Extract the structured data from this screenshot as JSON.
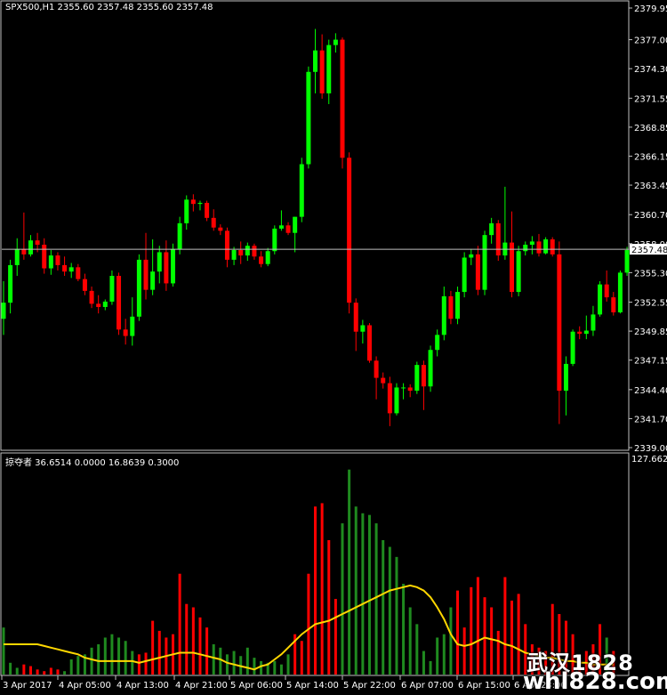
{
  "window": {
    "symbol_label": "SPX500,H1  2355.60 2357.48 2355.60 2357.48",
    "indicator_label": "掠夺者 36.6514 0.0000 16.8639 0.3000",
    "indicator_max": "127.6628",
    "current_price": "2357.48"
  },
  "colors": {
    "background": "#000000",
    "bull": "#00ff00",
    "bear": "#ff0000",
    "grid": "#c0c0c0",
    "price_line": "#c0c0c0",
    "ma_line": "#ffd700",
    "text": "#ffffff"
  },
  "price_axis_labels": [
    "2379.95",
    "2377.00",
    "2374.30",
    "2371.55",
    "2368.85",
    "2366.15",
    "2363.45",
    "2360.70",
    "2358.00",
    "2355.30",
    "2352.55",
    "2349.85",
    "2347.15",
    "2344.40",
    "2341.70",
    "2339.00"
  ],
  "time_axis_labels": [
    "3 Apr 2017",
    "4 Apr 05:00",
    "4 Apr 13:00",
    "4 Apr 21:00",
    "5 Apr 06:00",
    "5 Apr 14:00",
    "5 Apr 22:00",
    "6 Apr 07:00",
    "6 Apr 15:00",
    "6 Apr 23:00"
  ],
  "watermark": {
    "line1": "武汉1828",
    "line2": "whl828.com"
  },
  "chart_data": [
    {
      "type": "candlestick",
      "title": "SPX500,H1",
      "ylim": [
        2339.0,
        2379.95
      ],
      "candles": [
        [
          2351.0,
          2354.5,
          2349.5,
          2352.5
        ],
        [
          2352.5,
          2356.5,
          2351.5,
          2356.0
        ],
        [
          2356.0,
          2358.5,
          2355.0,
          2357.5
        ],
        [
          2357.5,
          2360.9,
          2356.5,
          2357.0
        ],
        [
          2357.0,
          2358.8,
          2356.8,
          2358.3
        ],
        [
          2358.3,
          2359.0,
          2357.2,
          2357.9
        ],
        [
          2357.9,
          2358.5,
          2355.2,
          2355.7
        ],
        [
          2355.7,
          2357.4,
          2355.1,
          2356.9
        ],
        [
          2356.9,
          2357.2,
          2355.5,
          2356.0
        ],
        [
          2356.0,
          2356.8,
          2355.0,
          2355.4
        ],
        [
          2355.4,
          2356.2,
          2354.8,
          2355.8
        ],
        [
          2355.8,
          2356.1,
          2354.5,
          2354.7
        ],
        [
          2354.7,
          2355.2,
          2353.2,
          2353.6
        ],
        [
          2353.6,
          2354.0,
          2352.0,
          2352.4
        ],
        [
          2352.4,
          2353.2,
          2351.5,
          2352.1
        ],
        [
          2352.1,
          2352.8,
          2351.8,
          2352.6
        ],
        [
          2352.6,
          2355.5,
          2352.3,
          2355.0
        ],
        [
          2355.0,
          2355.3,
          2349.5,
          2350.0
        ],
        [
          2350.0,
          2351.0,
          2348.6,
          2349.4
        ],
        [
          2349.4,
          2353.0,
          2348.5,
          2351.2
        ],
        [
          2351.2,
          2357.0,
          2350.8,
          2356.5
        ],
        [
          2356.5,
          2359.0,
          2352.8,
          2353.7
        ],
        [
          2353.7,
          2358.4,
          2353.2,
          2355.4
        ],
        [
          2355.4,
          2357.8,
          2354.3,
          2357.2
        ],
        [
          2357.2,
          2358.3,
          2353.6,
          2354.3
        ],
        [
          2354.3,
          2358.0,
          2354.0,
          2357.5
        ],
        [
          2357.5,
          2360.5,
          2357.0,
          2359.9
        ],
        [
          2359.9,
          2362.5,
          2359.3,
          2362.1
        ],
        [
          2362.1,
          2362.6,
          2361.0,
          2361.7
        ],
        [
          2361.7,
          2362.0,
          2361.1,
          2361.8
        ],
        [
          2361.8,
          2362.0,
          2360.1,
          2360.4
        ],
        [
          2360.4,
          2361.2,
          2359.2,
          2359.5
        ],
        [
          2359.5,
          2359.8,
          2358.8,
          2359.2
        ],
        [
          2359.2,
          2359.5,
          2355.8,
          2356.5
        ],
        [
          2356.5,
          2357.7,
          2356.0,
          2357.4
        ],
        [
          2357.4,
          2358.2,
          2356.1,
          2356.9
        ],
        [
          2356.9,
          2358.1,
          2356.4,
          2357.8
        ],
        [
          2357.8,
          2358.0,
          2356.5,
          2356.8
        ],
        [
          2356.8,
          2357.3,
          2355.8,
          2356.1
        ],
        [
          2356.1,
          2357.6,
          2355.9,
          2357.3
        ],
        [
          2357.3,
          2359.7,
          2357.0,
          2359.4
        ],
        [
          2359.4,
          2361.1,
          2359.2,
          2359.7
        ],
        [
          2359.7,
          2360.0,
          2358.8,
          2359.0
        ],
        [
          2359.0,
          2360.5,
          2357.2,
          2360.5
        ],
        [
          2360.5,
          2366.0,
          2360.0,
          2365.4
        ],
        [
          2365.4,
          2374.5,
          2365.0,
          2374.0
        ],
        [
          2374.0,
          2378.0,
          2372.0,
          2376.0
        ],
        [
          2376.0,
          2377.5,
          2371.5,
          2372.0
        ],
        [
          2372.0,
          2377.0,
          2371.0,
          2376.5
        ],
        [
          2376.5,
          2377.6,
          2375.8,
          2377.0
        ],
        [
          2377.0,
          2377.2,
          2365.0,
          2366.0
        ],
        [
          2366.0,
          2366.5,
          2351.5,
          2352.5
        ],
        [
          2352.5,
          2352.9,
          2348.0,
          2349.8
        ],
        [
          2349.8,
          2350.9,
          2348.7,
          2350.4
        ],
        [
          2350.4,
          2350.6,
          2346.9,
          2347.1
        ],
        [
          2347.1,
          2347.5,
          2343.5,
          2345.5
        ],
        [
          2345.5,
          2346.0,
          2344.5,
          2345.0
        ],
        [
          2345.0,
          2345.6,
          2341.0,
          2342.2
        ],
        [
          2342.2,
          2345.0,
          2342.0,
          2344.6
        ],
        [
          2344.6,
          2345.0,
          2343.5,
          2344.6
        ],
        [
          2344.6,
          2344.9,
          2343.7,
          2344.3
        ],
        [
          2344.3,
          2347.0,
          2344.0,
          2346.7
        ],
        [
          2346.7,
          2347.1,
          2342.5,
          2344.7
        ],
        [
          2344.7,
          2348.5,
          2344.2,
          2348.1
        ],
        [
          2348.1,
          2350.0,
          2347.5,
          2349.5
        ],
        [
          2349.5,
          2354.0,
          2349.0,
          2353.1
        ],
        [
          2353.1,
          2353.6,
          2350.5,
          2351.0
        ],
        [
          2351.0,
          2354.0,
          2350.5,
          2353.5
        ],
        [
          2353.5,
          2357.2,
          2353.0,
          2356.7
        ],
        [
          2356.7,
          2357.5,
          2356.0,
          2357.0
        ],
        [
          2357.0,
          2357.8,
          2353.2,
          2353.7
        ],
        [
          2353.7,
          2359.2,
          2353.2,
          2358.8
        ],
        [
          2358.8,
          2360.4,
          2358.0,
          2359.9
        ],
        [
          2359.9,
          2360.2,
          2356.4,
          2356.9
        ],
        [
          2356.9,
          2363.3,
          2356.5,
          2358.1
        ],
        [
          2358.1,
          2361.0,
          2353.0,
          2353.5
        ],
        [
          2353.5,
          2357.8,
          2353.1,
          2357.3
        ],
        [
          2357.3,
          2358.2,
          2356.9,
          2357.9
        ],
        [
          2357.9,
          2358.7,
          2357.0,
          2358.2
        ],
        [
          2358.2,
          2358.9,
          2356.8,
          2357.1
        ],
        [
          2357.1,
          2358.6,
          2357.0,
          2358.4
        ],
        [
          2358.4,
          2358.6,
          2356.8,
          2357.0
        ],
        [
          2357.0,
          2358.2,
          2341.2,
          2344.3
        ],
        [
          2344.3,
          2347.5,
          2342.0,
          2346.8
        ],
        [
          2346.8,
          2350.0,
          2346.6,
          2349.8
        ],
        [
          2349.8,
          2350.3,
          2349.1,
          2349.6
        ],
        [
          2349.6,
          2351.3,
          2349.1,
          2349.9
        ],
        [
          2349.9,
          2352.2,
          2349.4,
          2351.4
        ],
        [
          2351.4,
          2354.5,
          2351.2,
          2354.2
        ],
        [
          2354.2,
          2355.5,
          2352.6,
          2353.0
        ],
        [
          2353.0,
          2353.5,
          2351.3,
          2351.6
        ],
        [
          2351.6,
          2355.5,
          2351.5,
          2355.3
        ],
        [
          2355.3,
          2357.7,
          2355.0,
          2357.4
        ]
      ],
      "current_price": 2357.48
    },
    {
      "type": "bar",
      "title": "掠夺者",
      "ylim": [
        0,
        127.6628
      ],
      "values": [
        28,
        7,
        4,
        6,
        5,
        3,
        2,
        4,
        3,
        2,
        9,
        11,
        12,
        16,
        18,
        22,
        24,
        22,
        20,
        14,
        12,
        13,
        32,
        26,
        22,
        24,
        60,
        42,
        40,
        34,
        28,
        18,
        16,
        12,
        14,
        11,
        16,
        10,
        8,
        7,
        8,
        6,
        12,
        24,
        20,
        60,
        100,
        102,
        80,
        45,
        90,
        122,
        100,
        96,
        95,
        90,
        80,
        76,
        70,
        54,
        40,
        30,
        14,
        8,
        22,
        24,
        40,
        50,
        28,
        52,
        58,
        46,
        40,
        26,
        58,
        44,
        48,
        30,
        18,
        16,
        14,
        42,
        36,
        32,
        24,
        10,
        14,
        18,
        30,
        22,
        14
      ],
      "colors": "gggrrrrrrgggggggggggrrrrrrrrrrrggggggggggggrrrrrrrgggggggggggggggggrrrrrrrrrrrrrrrrrrrrrrgrrrrrr",
      "ma_values": [
        18,
        18,
        18,
        18,
        18,
        18,
        17,
        16,
        15,
        14,
        13,
        12,
        10,
        9,
        8,
        8,
        8,
        8,
        8,
        8,
        7,
        8,
        9,
        10,
        11,
        12,
        13,
        13,
        13,
        12,
        11,
        10,
        9,
        7,
        6,
        5,
        4,
        3,
        5,
        6,
        9,
        12,
        16,
        20,
        24,
        27,
        30,
        31,
        32,
        34,
        36,
        38,
        40,
        42,
        44,
        46,
        48,
        50,
        51,
        52,
        53,
        52,
        50,
        46,
        40,
        33,
        24,
        18,
        17,
        18,
        20,
        22,
        21,
        20,
        18,
        17,
        15,
        13,
        12,
        11,
        10,
        10,
        9,
        8,
        8,
        7,
        7,
        6,
        6,
        6,
        6
      ]
    }
  ]
}
